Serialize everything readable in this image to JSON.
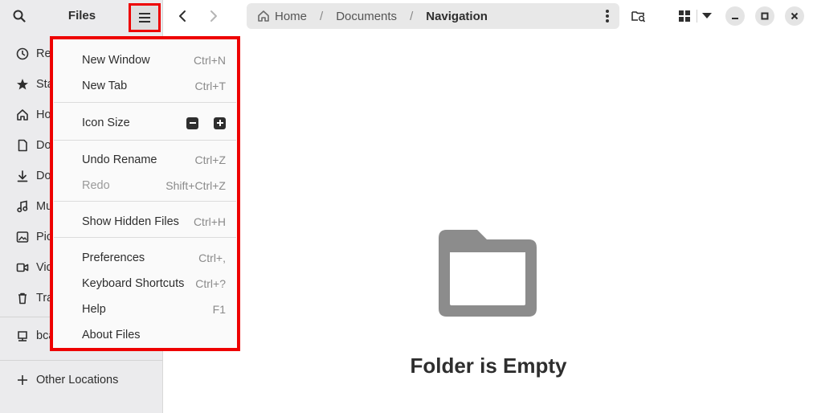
{
  "app": {
    "title": "Files"
  },
  "sidebar": {
    "items": [
      {
        "label": "Re",
        "icon": "recent-icon"
      },
      {
        "label": "Sta",
        "icon": "star-icon"
      },
      {
        "label": "Ho",
        "icon": "home-icon"
      },
      {
        "label": "Do",
        "icon": "document-icon"
      },
      {
        "label": "Do",
        "icon": "download-icon"
      },
      {
        "label": "Mu",
        "icon": "music-icon"
      },
      {
        "label": "Pic",
        "icon": "picture-icon"
      },
      {
        "label": "Vid",
        "icon": "video-icon"
      },
      {
        "label": "Tra",
        "icon": "trash-icon"
      },
      {
        "label": "bca",
        "icon": "network-drive-icon"
      }
    ],
    "other_locations": "Other Locations"
  },
  "pathbar": {
    "crumbs": [
      "Home",
      "Documents",
      "Navigation"
    ],
    "separator": "/"
  },
  "menu": {
    "new_window": {
      "label": "New Window",
      "shortcut": "Ctrl+N"
    },
    "new_tab": {
      "label": "New Tab",
      "shortcut": "Ctrl+T"
    },
    "icon_size": {
      "label": "Icon Size"
    },
    "undo_rename": {
      "label": "Undo Rename",
      "shortcut": "Ctrl+Z"
    },
    "redo": {
      "label": "Redo",
      "shortcut": "Shift+Ctrl+Z"
    },
    "show_hidden": {
      "label": "Show Hidden Files",
      "shortcut": "Ctrl+H"
    },
    "preferences": {
      "label": "Preferences",
      "shortcut": "Ctrl+,"
    },
    "keyboard_shortcuts": {
      "label": "Keyboard Shortcuts",
      "shortcut": "Ctrl+?"
    },
    "help": {
      "label": "Help",
      "shortcut": "F1"
    },
    "about": {
      "label": "About Files"
    }
  },
  "empty_state": {
    "title": "Folder is Empty"
  },
  "colors": {
    "highlight": "#ee0000",
    "sidebar_bg": "#ebebed",
    "pathbar_bg": "#e8e8e8"
  }
}
